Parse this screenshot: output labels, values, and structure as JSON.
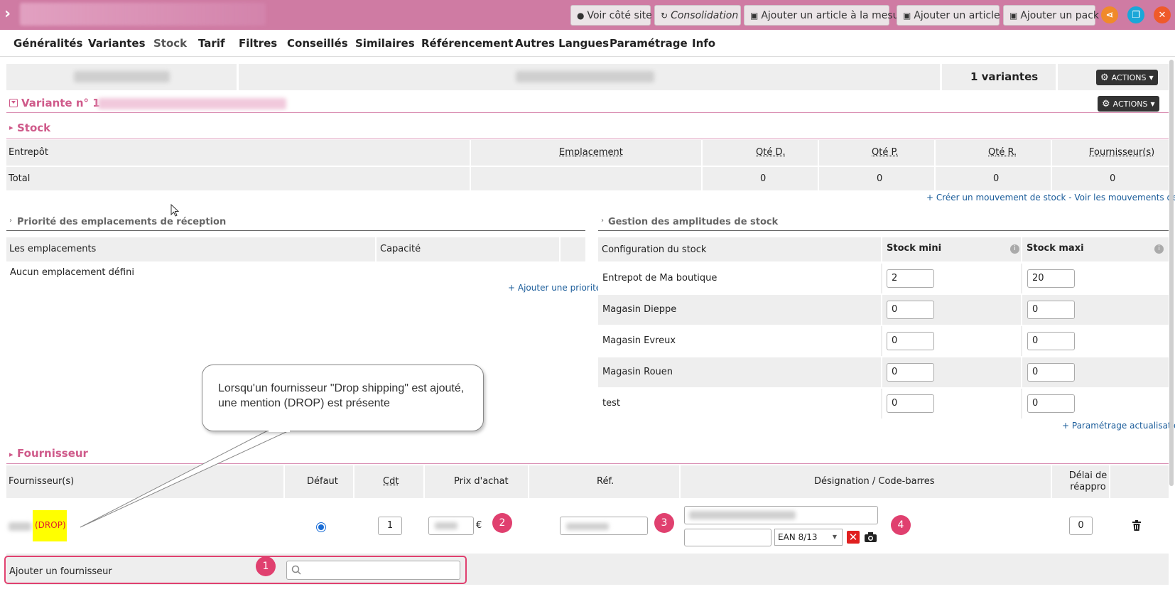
{
  "topbar": {
    "buttons": {
      "voir": "Voir côté site",
      "consolidation": "Consolidation",
      "article_mesure": "Ajouter un article à la mesure",
      "article": "Ajouter un article",
      "pack": "Ajouter un pack"
    },
    "icons": {
      "chevron": "›",
      "globe": "●",
      "refresh": "↻",
      "plus": "▣",
      "share": "⋖",
      "copy": "❐",
      "close": "✕"
    },
    "colors": {
      "bar": "#cf7ba3",
      "share": "#f08a2a",
      "copy": "#1aa7d8",
      "close": "#ef5a2a"
    }
  },
  "tabs": [
    "Généralités",
    "Variantes",
    "Stock",
    "Tarif",
    "Filtres",
    "Conseillés",
    "Similaires",
    "Référencement",
    "Autres Langues",
    "Paramétrage",
    "Info"
  ],
  "active_tab": "Stock",
  "variantes": {
    "count_label": "1 variantes",
    "actions": "ACTIONS"
  },
  "variante": {
    "title": "Variante n° 1 -",
    "actions": "ACTIONS"
  },
  "stock": {
    "section": "Stock",
    "headers": [
      "Entrepôt",
      "Emplacement",
      "Qté D.",
      "Qté P.",
      "Qté R.",
      "Fournisseur(s)"
    ],
    "total_label": "Total",
    "total_values": [
      "0",
      "0",
      "0",
      "0"
    ],
    "link_create": "+ Créer un mouvement de stock",
    "link_sep": " - ",
    "link_view": "Voir les mouvements de stock"
  },
  "priorite": {
    "title": "Priorité des emplacements de réception",
    "headers": [
      "Les emplacements",
      "Capacité"
    ],
    "empty": "Aucun emplacement défini",
    "add_link": "+ Ajouter une priorité"
  },
  "amplitudes": {
    "title": "Gestion des amplitudes de stock",
    "headers": [
      "Configuration du stock",
      "Stock mini",
      "Stock maxi"
    ],
    "rows": [
      {
        "name": "Entrepot de Ma boutique",
        "mini": "2",
        "maxi": "20"
      },
      {
        "name": "Magasin Dieppe",
        "mini": "0",
        "maxi": "0"
      },
      {
        "name": "Magasin Evreux",
        "mini": "0",
        "maxi": "0"
      },
      {
        "name": "Magasin Rouen",
        "mini": "0",
        "maxi": "0"
      },
      {
        "name": "test",
        "mini": "0",
        "maxi": "0"
      }
    ],
    "param_link": "+ Paramétrage actualisation"
  },
  "callout": {
    "text": "Lorsqu'un fournisseur \"Drop shipping\" est ajouté, une mention (DROP) est présente"
  },
  "fournisseur": {
    "section": "Fournisseur",
    "headers": [
      "Fournisseur(s)",
      "Défaut",
      "Cdt",
      "Prix d'achat",
      "Réf.",
      "Désignation / Code-barres"
    ],
    "delai_line1": "Délai de",
    "delai_line2": "réappro",
    "row": {
      "drop": "(DROP)",
      "cdt": "1",
      "currency": "€",
      "barcode_type": "EAN 8/13",
      "delai": "0"
    },
    "add_label": "Ajouter un fournisseur",
    "badges": [
      "1",
      "2",
      "3",
      "4"
    ]
  }
}
